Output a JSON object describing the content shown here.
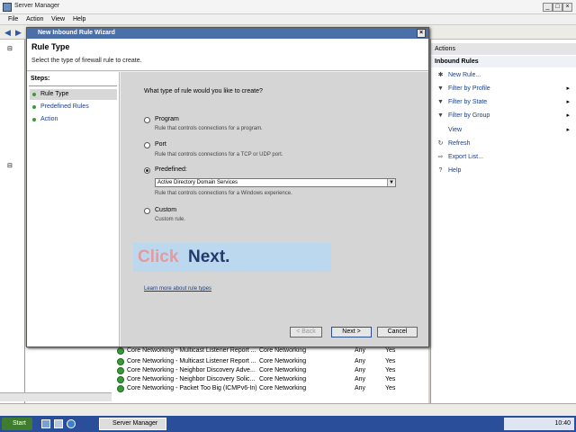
{
  "window": {
    "title": "Server Manager",
    "controls": {
      "minimize": "_",
      "maximize": "□",
      "close": "×"
    }
  },
  "menu": [
    "File",
    "Action",
    "View",
    "Help"
  ],
  "wizard": {
    "title": "New Inbound Rule Wizard",
    "heading": "Rule Type",
    "subheading": "Select the type of firewall rule to create.",
    "steps_label": "Steps:",
    "steps": [
      "Rule Type",
      "Predefined Rules",
      "Action"
    ],
    "question": "What type of rule would you like to create?",
    "options": [
      {
        "label": "Program",
        "desc": "Rule that controls connections for a program."
      },
      {
        "label": "Port",
        "desc": "Rule that controls connections for a TCP or UDP port."
      },
      {
        "label": "Predefined:",
        "desc": "Rule that controls connections for a Windows experience."
      },
      {
        "label": "Custom",
        "desc": "Custom rule."
      }
    ],
    "selected_option": "Predefined:",
    "predefined_value": "Active Directory Domain Services",
    "banner_click": "Click",
    "banner_next": "Next.",
    "learn_more": "Learn more about rule types",
    "back": "< Back",
    "next": "Next >",
    "cancel": "Cancel"
  },
  "rules": [
    {
      "name": "Core Networking - Multicast Listener Report ...",
      "group": "Core Networking",
      "profile": "Any",
      "enabled": "Yes"
    },
    {
      "name": "Core Networking - Multicast Listener Report ...",
      "group": "Core Networking",
      "profile": "Any",
      "enabled": "Yes"
    },
    {
      "name": "Core Networking - Neighbor Discovery Adve...",
      "group": "Core Networking",
      "profile": "Any",
      "enabled": "Yes"
    },
    {
      "name": "Core Networking - Neighbor Discovery Solic...",
      "group": "Core Networking",
      "profile": "Any",
      "enabled": "Yes"
    },
    {
      "name": "Core Networking - Packet Too Big (ICMPv6-In)",
      "group": "Core Networking",
      "profile": "Any",
      "enabled": "Yes"
    }
  ],
  "actions": {
    "header": "Actions",
    "section": "Inbound Rules",
    "items": [
      {
        "icon": "✱",
        "label": "New Rule...",
        "arrow": ""
      },
      {
        "icon": "▼",
        "label": "Filter by Profile",
        "arrow": "▸"
      },
      {
        "icon": "▼",
        "label": "Filter by State",
        "arrow": "▸"
      },
      {
        "icon": "▼",
        "label": "Filter by Group",
        "arrow": "▸"
      },
      {
        "icon": "",
        "label": "View",
        "arrow": "▸"
      },
      {
        "icon": "↻",
        "label": "Refresh",
        "arrow": ""
      },
      {
        "icon": "⇨",
        "label": "Export List...",
        "arrow": ""
      },
      {
        "icon": "?",
        "label": "Help",
        "arrow": ""
      }
    ]
  },
  "taskbar": {
    "start": "Start",
    "task": "Server Manager",
    "time": "10:40"
  }
}
